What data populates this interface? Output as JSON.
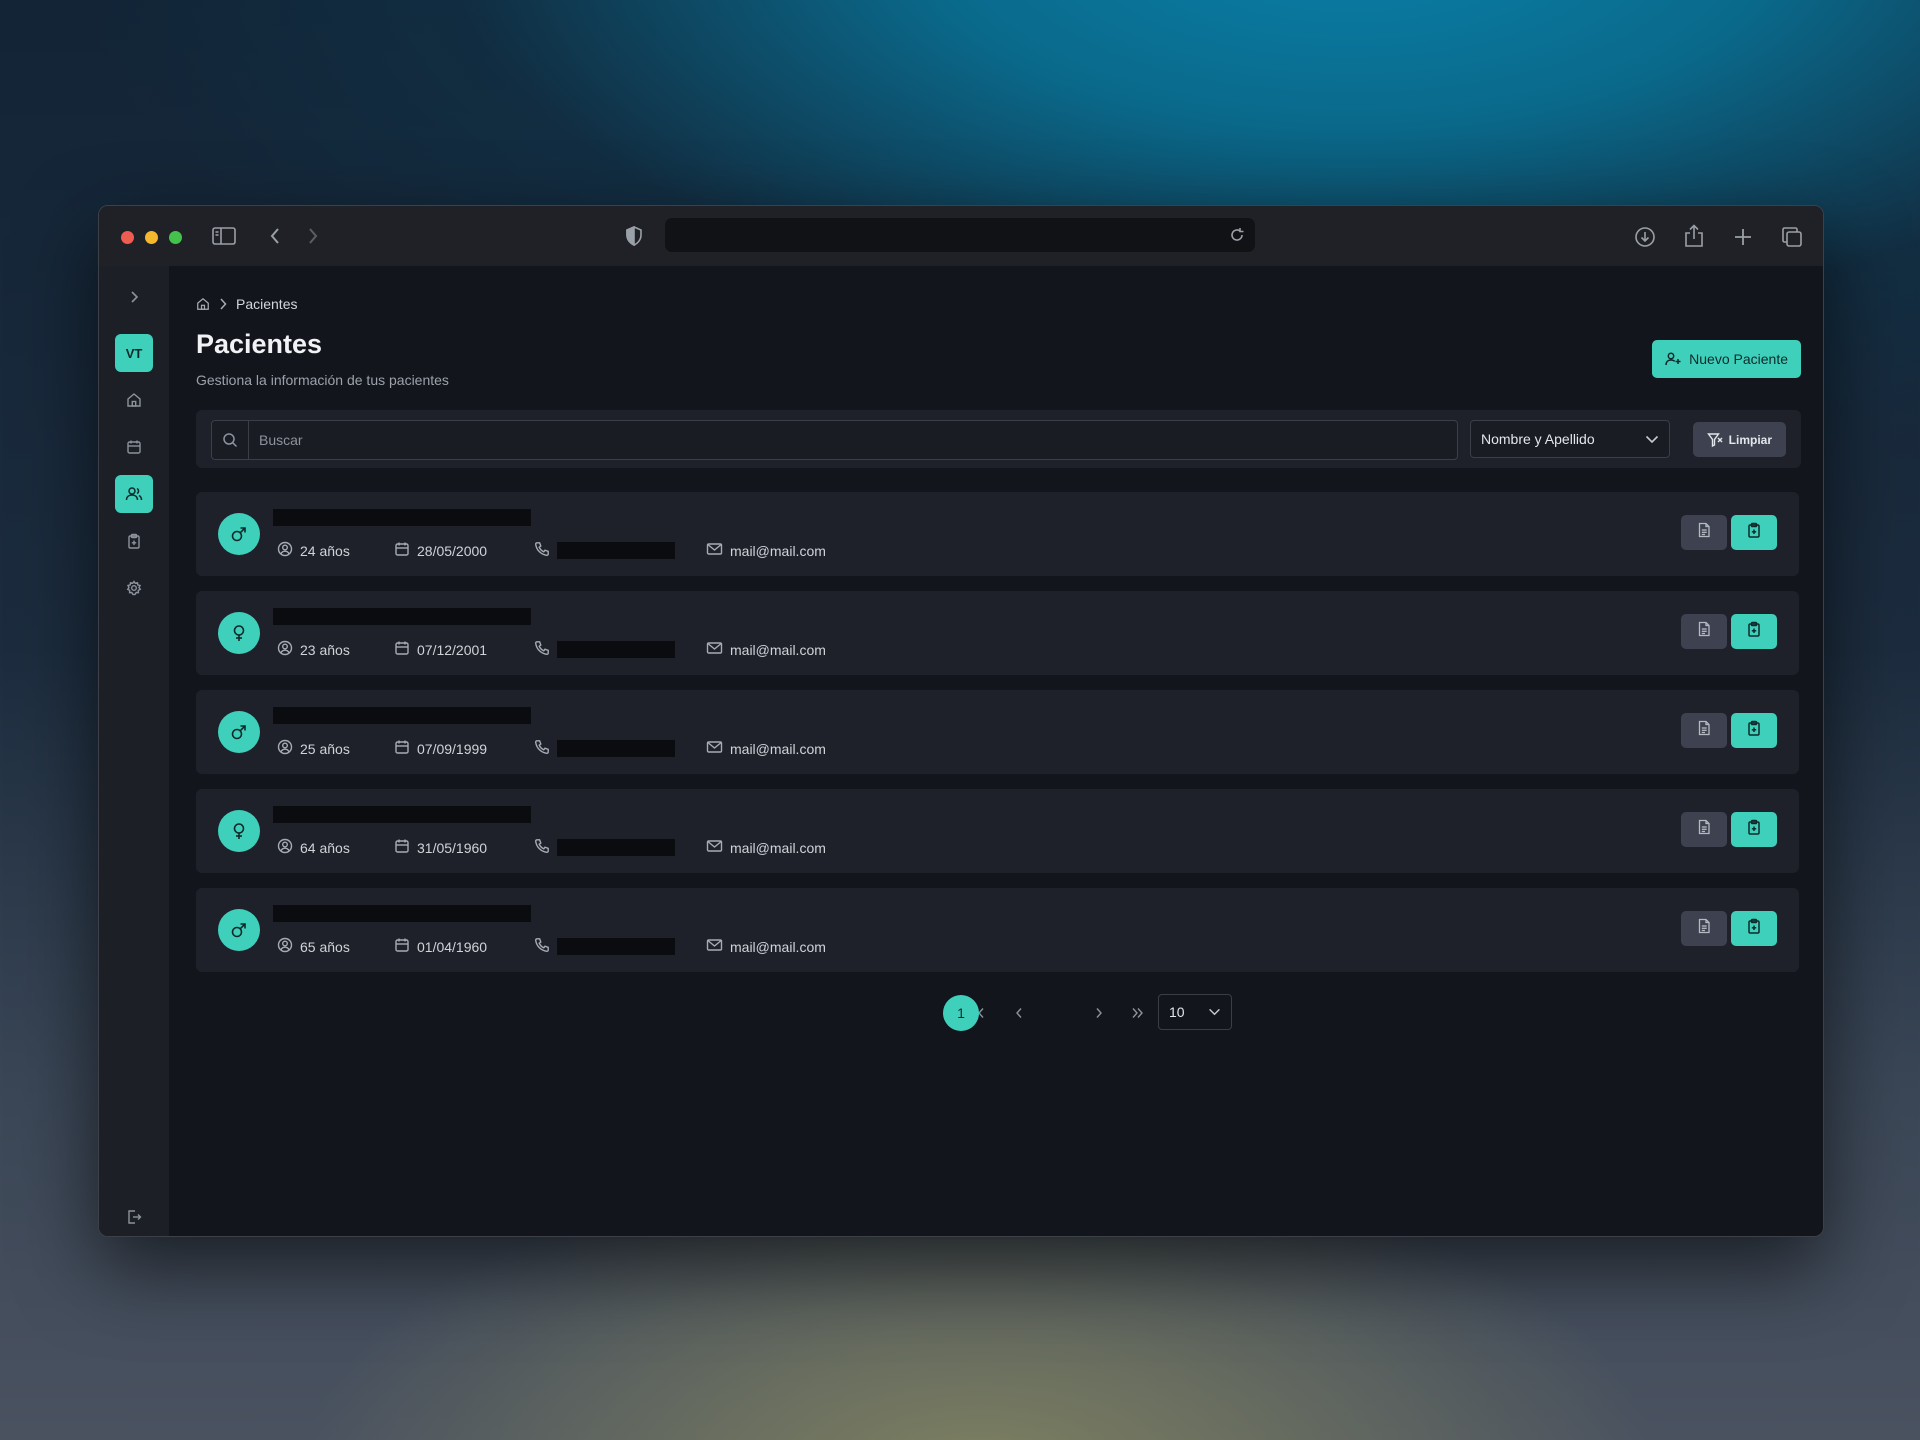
{
  "breadcrumb": {
    "current": "Pacientes"
  },
  "user": {
    "initials": "VT"
  },
  "header": {
    "title": "Pacientes",
    "subtitle": "Gestiona la información de tus pacientes"
  },
  "actions": {
    "new_patient_label": "Nuevo Paciente",
    "clear_label": "Limpiar"
  },
  "search": {
    "placeholder": "Buscar",
    "filter_field": "Nombre y Apellido"
  },
  "patients": [
    {
      "gender": "male",
      "age": "24 años",
      "birthdate": "28/05/2000",
      "email": "mail@mail.com"
    },
    {
      "gender": "female",
      "age": "23 años",
      "birthdate": "07/12/2001",
      "email": "mail@mail.com"
    },
    {
      "gender": "male",
      "age": "25 años",
      "birthdate": "07/09/1999",
      "email": "mail@mail.com"
    },
    {
      "gender": "female",
      "age": "64 años",
      "birthdate": "31/05/1960",
      "email": "mail@mail.com"
    },
    {
      "gender": "male",
      "age": "65 años",
      "birthdate": "01/04/1960",
      "email": "mail@mail.com"
    }
  ],
  "pagination": {
    "current_page": "1",
    "page_size": "10"
  },
  "colors": {
    "accent": "#3fd0bc",
    "surface": "#1e2129",
    "background": "#12151c"
  }
}
